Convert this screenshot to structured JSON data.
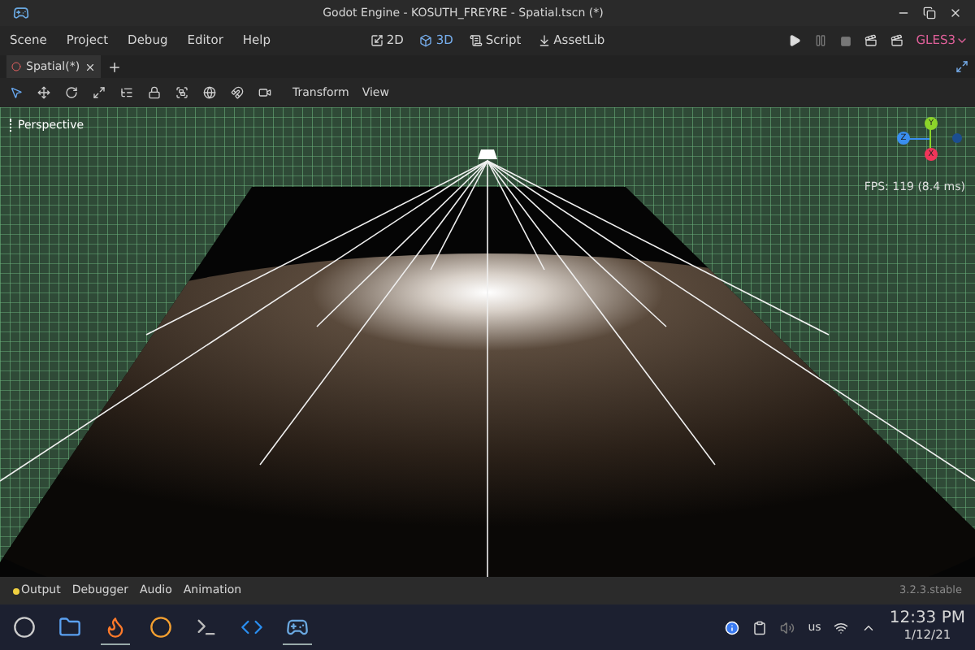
{
  "window": {
    "title": "Godot Engine - KOSUTH_FREYRE - Spatial.tscn (*)"
  },
  "menu": [
    "Scene",
    "Project",
    "Debug",
    "Editor",
    "Help"
  ],
  "workspaces": [
    {
      "label": "2D",
      "kind": "planar",
      "selected": false
    },
    {
      "label": "3D",
      "kind": "spatial",
      "selected": true
    },
    {
      "label": "Script",
      "kind": "script",
      "selected": false
    },
    {
      "label": "AssetLib",
      "kind": "assetlib",
      "selected": false
    }
  ],
  "renderer": "GLES3",
  "scene_tabs": [
    {
      "label": "Spatial(*)",
      "selected": true
    }
  ],
  "tools": [
    {
      "kind": "select",
      "selected": true
    },
    {
      "kind": "move",
      "selected": false
    },
    {
      "kind": "rotate",
      "selected": false
    },
    {
      "kind": "scale",
      "selected": false
    },
    {
      "kind": "list",
      "selected": false
    },
    {
      "kind": "lock",
      "selected": false
    },
    {
      "kind": "group",
      "selected": false
    },
    {
      "kind": "local",
      "selected": false
    },
    {
      "kind": "snap",
      "selected": false
    },
    {
      "kind": "camera",
      "selected": false
    }
  ],
  "toolbar_menus": [
    "Transform",
    "View"
  ],
  "viewport": {
    "view_label": "Perspective",
    "fps": "FPS: 119 (8.4 ms)",
    "gizmo": [
      {
        "label": "Y",
        "color": "#8cd42a"
      },
      {
        "label": "X",
        "color": "#f0355a"
      },
      {
        "label": "Z",
        "color": "#3a8ef0"
      }
    ]
  },
  "bottom_tabs": [
    {
      "label": "Output",
      "indicator": true
    },
    {
      "label": "Debugger",
      "indicator": false
    },
    {
      "label": "Audio",
      "indicator": false
    },
    {
      "label": "Animation",
      "indicator": false
    }
  ],
  "version": "3.2.3.stable",
  "taskbar": {
    "apps": [
      {
        "kind": "menu",
        "active": false
      },
      {
        "kind": "files",
        "active": false
      },
      {
        "kind": "browser",
        "active": true
      },
      {
        "kind": "blender",
        "active": false
      },
      {
        "kind": "terminal",
        "active": false
      },
      {
        "kind": "code",
        "active": false
      },
      {
        "kind": "godot",
        "active": true
      }
    ],
    "keyboard": "us",
    "time": "12:33 PM",
    "date": "1/12/21"
  }
}
